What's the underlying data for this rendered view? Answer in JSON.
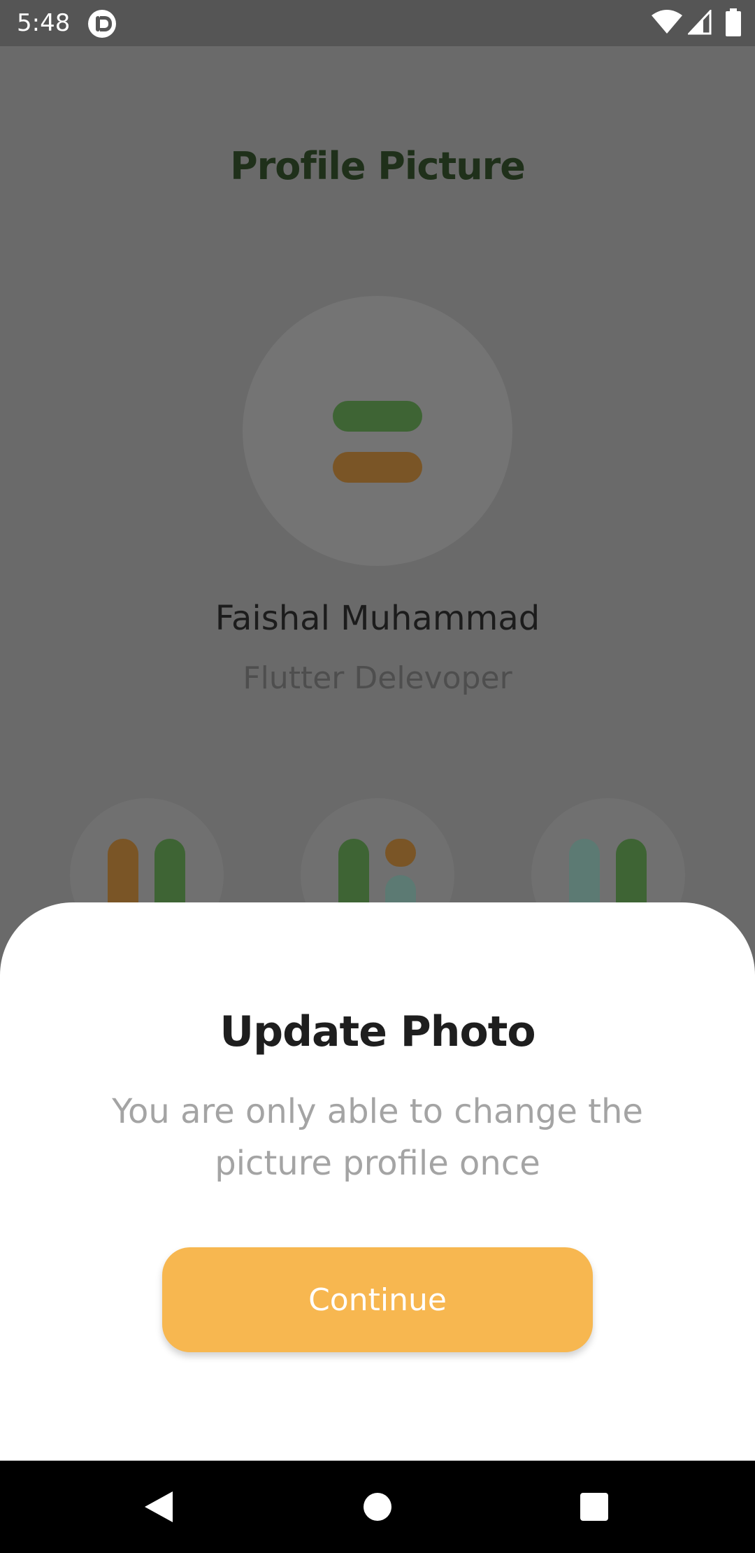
{
  "status_bar": {
    "time": "5:48",
    "icons": [
      "app-notification-icon",
      "wifi-icon",
      "signal-icon",
      "battery-icon"
    ]
  },
  "profile": {
    "title": "Profile Picture",
    "name": "Faishal Muhammad",
    "role": "Flutter Delevoper"
  },
  "dialog": {
    "title": "Update Photo",
    "message": "You are only able to change the picture profile once",
    "continue_label": "Continue"
  },
  "colors": {
    "sheet_background": "#ffffff",
    "button": "#f7b750",
    "green_dimmed": "#3e6434",
    "brown_dimmed": "#7a5526",
    "teal_dimmed": "#5c7a73",
    "nav_bar": "#000000"
  },
  "nav_bar": {
    "icons": [
      "back-icon",
      "home-icon",
      "recents-icon"
    ]
  }
}
